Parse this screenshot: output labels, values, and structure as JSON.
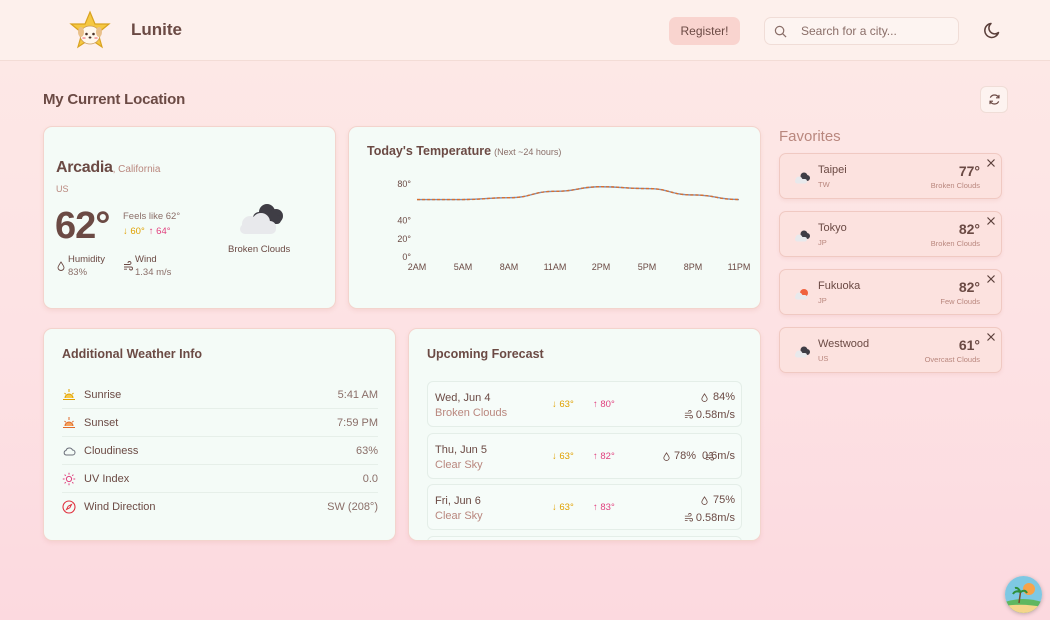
{
  "header": {
    "app_name": "Lunite",
    "register_label": "Register!",
    "search_placeholder": "Search for a city..."
  },
  "location": {
    "section_title": "My Current Location",
    "city": "Arcadia",
    "region": ", California",
    "country": "US",
    "temperature": "62°",
    "feels_like": "Feels like 62°",
    "min": "↓ 60°",
    "max": "↑ 64°",
    "humidity_label": "Humidity",
    "humidity_value": "83%",
    "wind_label": "Wind",
    "wind_value": "1.34 m/s",
    "condition": "Broken Clouds",
    "condition_icon": "broken-clouds-icon"
  },
  "temperature_chart": {
    "title": "Today's Temperature",
    "subtitle": "(Next ~24 hours)"
  },
  "chart_data": {
    "type": "line",
    "title": "Today's Temperature",
    "subtitle": "(Next ~24 hours)",
    "x": [
      "2AM",
      "5AM",
      "8AM",
      "11AM",
      "2PM",
      "5PM",
      "8PM",
      "11PM"
    ],
    "y_ticks": [
      "80°",
      "40°",
      "20°",
      "0°"
    ],
    "series": [
      {
        "values": [
          63,
          63,
          65,
          72,
          77,
          75,
          68,
          63
        ]
      }
    ],
    "grid": false,
    "colors": [
      "#d9702f",
      "#7d8fb5"
    ]
  },
  "additional_info": {
    "title": "Additional Weather Info",
    "rows": [
      {
        "label": "Sunrise",
        "value": "5:41 AM",
        "icon": "sunrise-icon"
      },
      {
        "label": "Sunset",
        "value": "7:59 PM",
        "icon": "sunset-icon"
      },
      {
        "label": "Cloudiness",
        "value": "63%",
        "icon": "cloud-icon"
      },
      {
        "label": "UV Index",
        "value": "0.0",
        "icon": "sun-icon"
      },
      {
        "label": "Wind Direction",
        "value": "SW (208°)",
        "icon": "compass-icon"
      }
    ]
  },
  "forecast": {
    "title": "Upcoming Forecast",
    "items": [
      {
        "date": "Wed, Jun 4",
        "condition": "Broken Clouds",
        "min": "↓ 63°",
        "max": "↑ 80°",
        "humidity": "84%",
        "wind": "0.58m/s"
      },
      {
        "date": "Thu, Jun 5",
        "condition": "Clear Sky",
        "min": "↓ 63°",
        "max": "↑ 82°",
        "humidity": "78%",
        "wind": "0.6m/s"
      },
      {
        "date": "Fri, Jun 6",
        "condition": "Clear Sky",
        "min": "↓ 63°",
        "max": "↑ 83°",
        "humidity": "75%",
        "wind": "0.58m/s"
      }
    ]
  },
  "favorites": {
    "title": "Favorites",
    "items": [
      {
        "city": "Taipei",
        "country": "TW",
        "temp": "77°",
        "condition": "Broken Clouds",
        "icon": "broken-clouds-icon"
      },
      {
        "city": "Tokyo",
        "country": "JP",
        "temp": "82°",
        "condition": "Broken Clouds",
        "icon": "broken-clouds-icon"
      },
      {
        "city": "Fukuoka",
        "country": "JP",
        "temp": "82°",
        "condition": "Few Clouds",
        "icon": "few-clouds-icon"
      },
      {
        "city": "Westwood",
        "country": "US",
        "temp": "61°",
        "condition": "Overcast Clouds",
        "icon": "overcast-clouds-icon"
      }
    ]
  },
  "colors": {
    "accent_text": "#6b4a44",
    "muted_text": "#b9877e",
    "min_temp": "#e0a100",
    "max_temp": "#e0407e",
    "card_bg": "#f4fbf7",
    "favorite_bg": "#fce2df"
  }
}
